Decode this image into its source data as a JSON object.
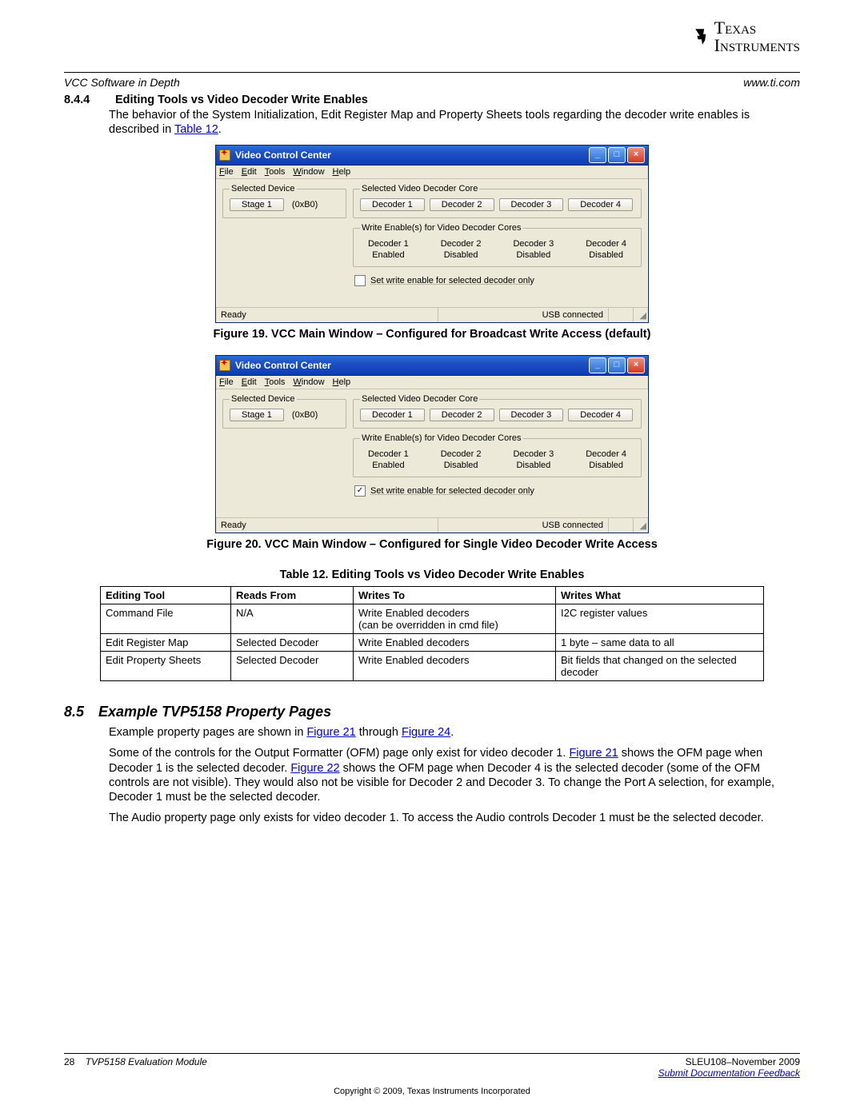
{
  "logo_text": "Texas\nInstruments",
  "header": {
    "left": "VCC Software in Depth",
    "right": "www.ti.com"
  },
  "s844": {
    "num": "8.4.4",
    "title": "Editing Tools vs Video Decoder Write Enables",
    "para_a": "The behavior of the System Initialization, Edit Register Map and Property Sheets tools regarding the decoder write enables is described in ",
    "para_link": "Table 12",
    "para_b": "."
  },
  "vcc": {
    "title": "Video Control Center",
    "menu": {
      "file": "File",
      "edit": "Edit",
      "tools": "Tools",
      "window": "Window",
      "help": "Help"
    },
    "sel_dev_legend": "Selected Device",
    "stage_btn": "Stage 1",
    "hex": "(0xB0)",
    "core_legend": "Selected Video Decoder Core",
    "dec1": "Decoder 1",
    "dec2": "Decoder 2",
    "dec3": "Decoder 3",
    "dec4": "Decoder 4",
    "we_legend": "Write Enable(s) for Video Decoder Cores",
    "enabled": "Enabled",
    "disabled": "Disabled",
    "chk_label": "Set write enable for selected decoder only",
    "status_ready": "Ready",
    "status_usb": "USB connected"
  },
  "fig19": "Figure 19. VCC Main Window – Configured for Broadcast Write Access (default)",
  "fig20": "Figure 20. VCC Main Window – Configured for Single Video Decoder Write Access",
  "table12_caption": "Table 12. Editing Tools vs Video Decoder Write Enables",
  "t12": {
    "h1": "Editing Tool",
    "h2": "Reads From",
    "h3": "Writes To",
    "h4": "Writes What",
    "r1c1": "Command File",
    "r1c2": "N/A",
    "r1c3": "Write Enabled decoders\n(can be overridden in cmd file)",
    "r1c4": "I2C register values",
    "r2c1": "Edit Register Map",
    "r2c2": "Selected Decoder",
    "r2c3": "Write Enabled decoders",
    "r2c4": "1 byte – same data to all",
    "r3c1": "Edit Property Sheets",
    "r3c2": "Selected Decoder",
    "r3c3": "Write Enabled decoders",
    "r3c4": "Bit fields that changed on the selected decoder"
  },
  "s85": {
    "num": "8.5",
    "title": "Example TVP5158 Property Pages",
    "p1a": "Example property pages are shown in ",
    "p1_l1": "Figure 21",
    "p1b": " through ",
    "p1_l2": "Figure 24",
    "p1c": ".",
    "p2a": "Some of the controls for the Output Formatter (OFM) page only exist for video decoder 1. ",
    "p2_l1": "Figure 21",
    "p2b": " shows the OFM page when Decoder 1 is the selected decoder. ",
    "p2_l2": "Figure 22",
    "p2c": " shows the OFM page when Decoder 4 is the selected decoder (some of the OFM controls are not visible). They would also not be visible for Decoder 2 and Decoder 3. To change the Port A selection, for example, Decoder 1 must be the selected decoder.",
    "p3": "The Audio property page only exists for video decoder 1. To access the Audio controls Decoder 1 must be the selected decoder."
  },
  "footer": {
    "page": "28",
    "doc": "TVP5158 Evaluation Module",
    "rev": "SLEU108–November 2009",
    "feedback": "Submit Documentation Feedback",
    "copyright": "Copyright © 2009, Texas Instruments Incorporated"
  }
}
